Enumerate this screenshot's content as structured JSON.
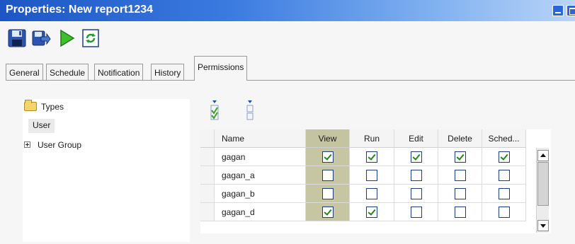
{
  "window": {
    "title": "Properties: New report1234"
  },
  "toolbar": {
    "items": [
      {
        "name": "save",
        "icon": "save-icon"
      },
      {
        "name": "save-as",
        "icon": "save-as-icon"
      },
      {
        "name": "run",
        "icon": "run-icon"
      },
      {
        "name": "refresh",
        "icon": "refresh-icon"
      }
    ]
  },
  "tabs": [
    {
      "label": "General",
      "active": false
    },
    {
      "label": "Schedule",
      "active": false
    },
    {
      "label": "Notification",
      "active": false
    },
    {
      "label": "History",
      "active": false
    },
    {
      "label": "Permissions",
      "active": true
    }
  ],
  "tree": {
    "root": {
      "label": "Types",
      "icon": "folder-icon"
    },
    "items": [
      {
        "label": "User",
        "selected": true
      },
      {
        "label": "User Group",
        "expandable": true
      }
    ]
  },
  "grid_toolbar": {
    "check_all_icon": "check-all-icon",
    "uncheck_all_icon": "uncheck-all-icon"
  },
  "grid": {
    "columns": [
      "Name",
      "View",
      "Run",
      "Edit",
      "Delete",
      "Sched..."
    ],
    "rows": [
      {
        "name": "gagan",
        "view": true,
        "run": true,
        "edit": true,
        "delete": true,
        "sched": true
      },
      {
        "name": "gagan_a",
        "view": false,
        "run": false,
        "edit": false,
        "delete": false,
        "sched": false
      },
      {
        "name": "gagan_b",
        "view": false,
        "run": false,
        "edit": false,
        "delete": false,
        "sched": false
      },
      {
        "name": "gagan_d",
        "view": true,
        "run": true,
        "edit": false,
        "delete": false,
        "sched": false
      }
    ]
  },
  "colors": {
    "titlebar": "#1c56c4",
    "view_column": "#c6c6a2",
    "check": "#1a8a1a"
  }
}
